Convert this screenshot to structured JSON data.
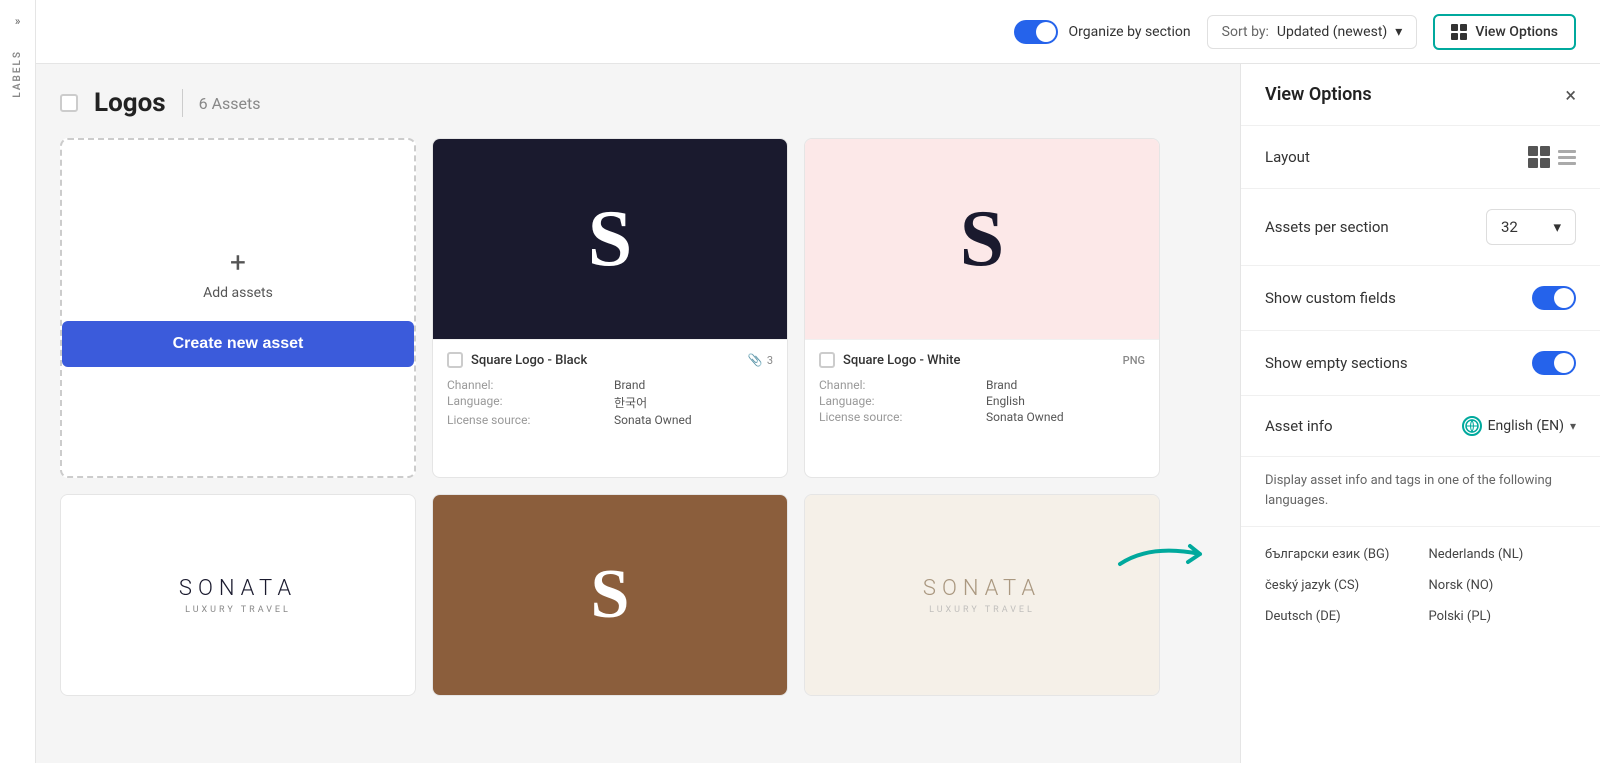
{
  "sidebar": {
    "chevron": "»",
    "labels_text": "LABELS"
  },
  "topbar": {
    "organize_label": "Organize by section",
    "sort_prefix": "Sort by:",
    "sort_value": "Updated (newest)",
    "view_options_label": "View Options"
  },
  "section": {
    "title": "Logos",
    "count_label": "6 Assets"
  },
  "add_asset": {
    "plus": "+",
    "label": "Add assets",
    "create_btn": "Create new asset"
  },
  "assets": [
    {
      "name": "Square Logo - Black",
      "badge_type": "clip",
      "badge_value": "3",
      "preview_type": "dark",
      "meta": [
        {
          "key": "Channel:",
          "val": "Brand"
        },
        {
          "key": "Language:",
          "val": "한국어"
        },
        {
          "key": "License source:",
          "val": "Sonata Owned"
        }
      ]
    },
    {
      "name": "Square Logo - White",
      "badge_type": "png",
      "badge_value": "PNG",
      "preview_type": "light-pink",
      "meta": [
        {
          "key": "Channel:",
          "val": "Brand"
        },
        {
          "key": "Language:",
          "val": "English"
        },
        {
          "key": "License source:",
          "val": "Sonata Owned"
        }
      ]
    }
  ],
  "view_options": {
    "title": "View Options",
    "close_icon": "×",
    "layout_label": "Layout",
    "assets_per_section_label": "Assets per section",
    "assets_per_section_value": "32",
    "show_custom_fields_label": "Show custom fields",
    "show_empty_sections_label": "Show empty sections",
    "asset_info_label": "Asset info",
    "asset_info_lang": "English (EN)",
    "description": "Display asset info and tags in one of the following languages.",
    "languages": [
      {
        "code": "BG",
        "name": "български език (BG)"
      },
      {
        "code": "CS",
        "name": "český jazyk (CS)"
      },
      {
        "code": "DE",
        "name": "Deutsch (DE)"
      },
      {
        "code": "NL",
        "name": "Nederlands (NL)"
      },
      {
        "code": "NO",
        "name": "Norsk (NO)"
      },
      {
        "code": "PL",
        "name": "Polski (PL)"
      }
    ]
  }
}
